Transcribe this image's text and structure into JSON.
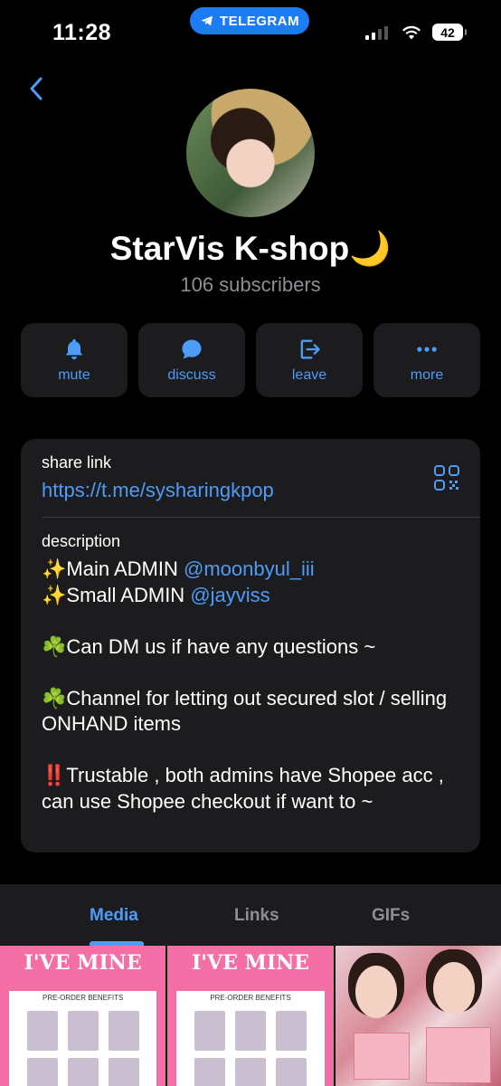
{
  "status_bar": {
    "time": "11:28",
    "app_pill": "TELEGRAM",
    "battery": "42"
  },
  "channel": {
    "name": "StarVis K-shop🌙",
    "subscribers": "106 subscribers"
  },
  "actions": [
    {
      "label": "mute",
      "icon": "bell-icon"
    },
    {
      "label": "discuss",
      "icon": "chat-bubble-icon"
    },
    {
      "label": "leave",
      "icon": "leave-icon"
    },
    {
      "label": "more",
      "icon": "more-dots-icon"
    }
  ],
  "info": {
    "share_label": "share link",
    "share_url": "https://t.me/sysharingkpop",
    "description_label": "description",
    "description": {
      "line1_prefix": "✨Main ADMIN ",
      "line1_mention": "@moonbyul_iii",
      "line2_prefix": "✨Small ADMIN ",
      "line2_mention": "@jayviss",
      "line3": "☘️Can DM us if have any questions ~",
      "line4": "☘️Channel for letting out secured slot / selling ONHAND items",
      "line5": "‼️Trustable , both admins have Shopee acc , can use Shopee checkout if want to ~"
    }
  },
  "tabs": [
    {
      "label": "Media",
      "active": true
    },
    {
      "label": "Links",
      "active": false
    },
    {
      "label": "GIFs",
      "active": false
    }
  ],
  "media": [
    {
      "title": "I'VE MINE",
      "subtitle": "PRE-ORDER BENEFITS"
    },
    {
      "title": "I'VE MINE",
      "subtitle": "PRE-ORDER BENEFITS"
    },
    {
      "title": ""
    }
  ],
  "colors": {
    "accent": "#4c9cf8",
    "background": "#000000",
    "card": "#1c1c1e",
    "secondary_text": "#8e8e93"
  }
}
